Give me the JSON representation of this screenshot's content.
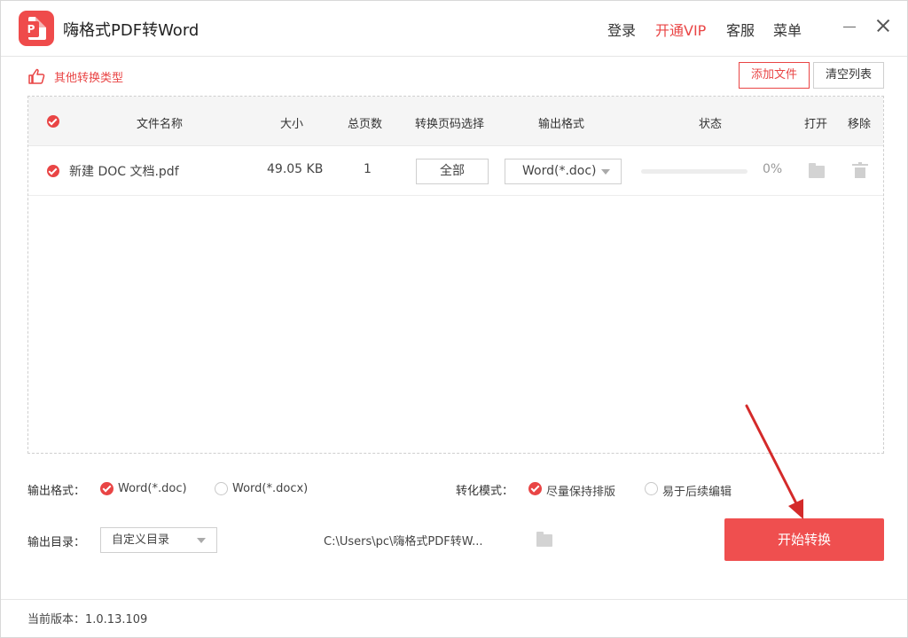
{
  "app": {
    "title": "嗨格式PDF转Word",
    "logo_letter": "P"
  },
  "top_nav": {
    "login": "登录",
    "vip": "开通VIP",
    "service": "客服",
    "menu": "菜单"
  },
  "toolbar": {
    "other_types": "其他转换类型",
    "add_file": "添加文件",
    "clear_list": "清空列表"
  },
  "table": {
    "headers": {
      "name": "文件名称",
      "size": "大小",
      "pages": "总页数",
      "page_select": "转换页码选择",
      "output_format": "输出格式",
      "status": "状态",
      "open": "打开",
      "remove": "移除"
    },
    "rows": [
      {
        "name": "新建 DOC 文档.pdf",
        "size": "49.05 KB",
        "pages": "1",
        "page_select": "全部",
        "format": "Word(*.doc)",
        "progress_text": "0%",
        "progress": 0
      }
    ]
  },
  "options": {
    "output_format_label": "输出格式：",
    "format_doc": "Word(*.doc)",
    "format_docx": "Word(*.docx)",
    "mode_label": "转化模式：",
    "mode_keep": "尽量保持排版",
    "mode_edit": "易于后续编辑",
    "output_dir_label": "输出目录：",
    "output_dir_value": "自定义目录",
    "output_path": "C:\\Users\\pc\\嗨格式PDF转W..."
  },
  "start_button": "开始转换",
  "footer": {
    "version": "当前版本：1.0.13.109"
  },
  "colors": {
    "accent": "#e94545",
    "button": "#ef4f4f",
    "arrow": "#d42a2a"
  }
}
